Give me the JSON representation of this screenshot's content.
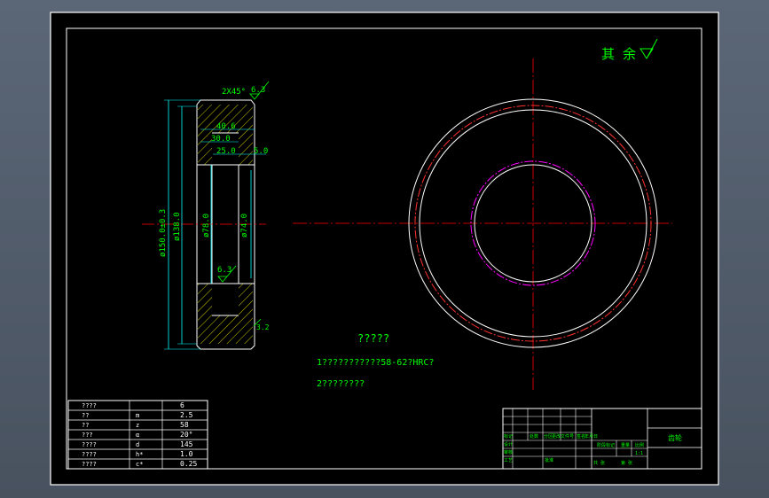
{
  "drawing": {
    "corner_note": "其 余",
    "chamfer_label": "2X45°",
    "roughness_top": "6.3",
    "roughness_mid": "6.3",
    "roughness_side": "3.2",
    "dim_40": "40.6",
    "dim_30": "30.0",
    "dim_25": "25.0",
    "dim_5": "5.0",
    "dia_outer": "ø150.0±0.3",
    "dia_138": "ø138.0",
    "dia_78": "ø78.0",
    "dia_74": "ø74.0",
    "notes_title": "?????",
    "note_1": "1???????????58-62?HRC?",
    "note_2": "2????????"
  },
  "param_table": {
    "rows": [
      {
        "name": "????",
        "sym": "",
        "val": "6"
      },
      {
        "name": "??",
        "sym": "m",
        "val": "2.5"
      },
      {
        "name": "??",
        "sym": "z",
        "val": "58"
      },
      {
        "name": "???",
        "sym": "α",
        "val": "20°"
      },
      {
        "name": "????",
        "sym": "d",
        "val": "145"
      },
      {
        "name": "????",
        "sym": "h*",
        "val": "1.0"
      },
      {
        "name": "????",
        "sym": "c*",
        "val": "0.25"
      }
    ]
  },
  "title_block": {
    "part_name": "齿轮",
    "labels": [
      "标记",
      "处数",
      "分区",
      "更改文件号",
      "签名",
      "年月日"
    ],
    "role_design": "设计",
    "role_check": "审核",
    "role_process": "工艺",
    "role_approve": "批准",
    "stage_label": "阶段标记",
    "weight_label": "重量",
    "scale_label": "比例",
    "scale_val": "1:1",
    "sheet_label": "共 张",
    "sheet_of": "第 张"
  }
}
